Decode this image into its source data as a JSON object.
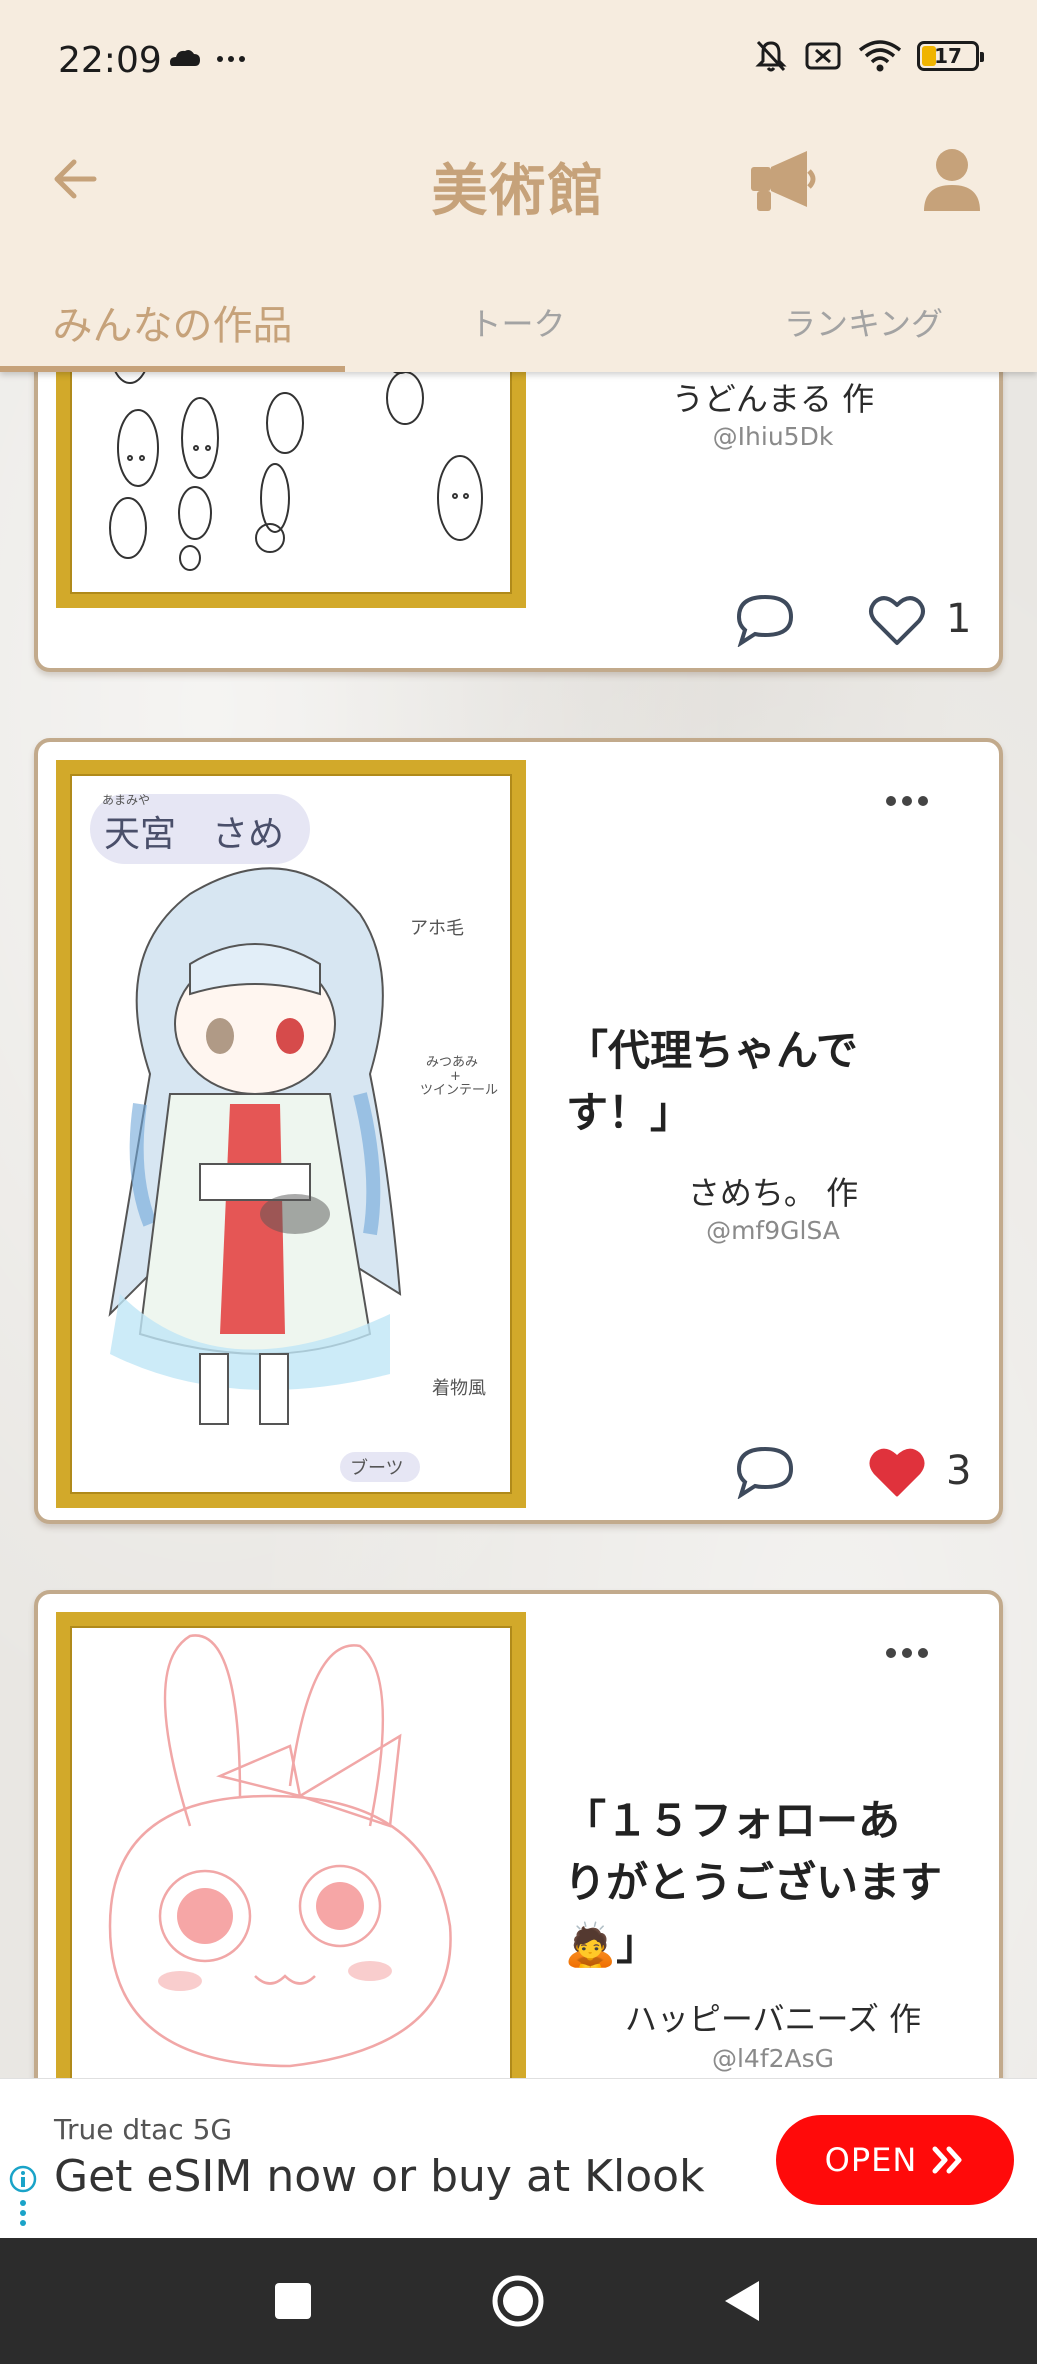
{
  "status_bar": {
    "time": "22:09",
    "left_icons": [
      "cloud-icon",
      "more-dots-icon"
    ],
    "right_icons": [
      "bell-muted-icon",
      "sim-off-icon",
      "wifi-icon"
    ],
    "battery": "17"
  },
  "app_bar": {
    "title": "美術館",
    "icons": [
      "back-arrow-icon",
      "megaphone-icon",
      "profile-icon"
    ],
    "accent_color": "#c6a27a",
    "background_color": "#f6ecdf"
  },
  "tabs": [
    {
      "label": "みんなの作品",
      "selected": true
    },
    {
      "label": "トーク",
      "selected": false
    },
    {
      "label": "ランキング",
      "selected": false
    }
  ],
  "posts": [
    {
      "author": "うどんまる 作",
      "handle": "@Ihiu5Dk",
      "liked": false,
      "like_count": "1",
      "artwork_icon": "doodle-characters-artwork"
    },
    {
      "title_line1": "「代理ちゃんで",
      "title_line2": "す！」",
      "author": "さめち。 作",
      "handle": "@mf9GlSA",
      "liked": true,
      "like_count": "3",
      "artwork_icon": "anime-girl-artwork",
      "artwork_text": {
        "name_ruby": "あまみや",
        "name": "天宮　さめ",
        "note1": "アホ毛",
        "note2_a": "みつあみ",
        "note2_b": "+",
        "note2_c": "ツインテール",
        "note3": "着物風",
        "note4": "ブーツ"
      }
    },
    {
      "title_line1": "「１５フォローあ",
      "title_line2": "りがとうございます",
      "title_line3_emoji": "🙇",
      "title_line3_text": "」",
      "author": "ハッピーバニーズ 作",
      "handle": "@l4f2AsG",
      "artwork_icon": "bunny-sketch-artwork"
    }
  ],
  "colors": {
    "frame_gold": "#d2a92a",
    "card_border": "#c2aa8c",
    "heart_red": "#e0323c",
    "ad_button": "#ff0a0a"
  },
  "ad": {
    "advertiser": "True dtac 5G",
    "headline": "Get eSIM now or buy at Klook",
    "button_label": "OPEN",
    "button_chevrons": "»"
  },
  "system_nav": [
    "recents-square-icon",
    "home-circle-icon",
    "back-triangle-icon"
  ]
}
